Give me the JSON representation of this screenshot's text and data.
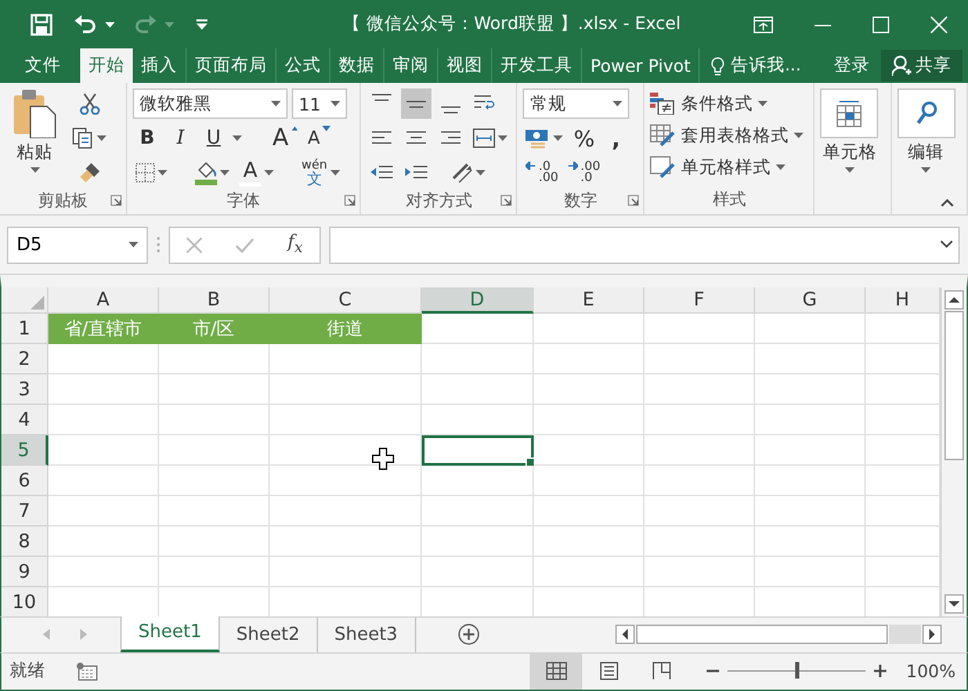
{
  "window": {
    "title": "【 微信公众号：Word联盟 】.xlsx - Excel"
  },
  "tabs": [
    {
      "label": "文件",
      "selected": false
    },
    {
      "label": "开始",
      "selected": true
    },
    {
      "label": "插入",
      "selected": false
    },
    {
      "label": "页面布局",
      "selected": false
    },
    {
      "label": "公式",
      "selected": false
    },
    {
      "label": "数据",
      "selected": false
    },
    {
      "label": "审阅",
      "selected": false
    },
    {
      "label": "视图",
      "selected": false
    },
    {
      "label": "开发工具",
      "selected": false
    },
    {
      "label": "Power Pivot",
      "selected": false
    }
  ],
  "tell_me": "告诉我...",
  "sign_in": "登录",
  "share": "共享",
  "ribbon": {
    "clipboard": {
      "label": "剪贴板",
      "paste": "粘贴"
    },
    "font": {
      "label": "字体",
      "font_name": "微软雅黑",
      "font_size": "11",
      "format_buttons": [
        {
          "kind": "bold",
          "label": "B"
        },
        {
          "kind": "italic",
          "label": "I"
        },
        {
          "kind": "underline",
          "label": "U"
        }
      ],
      "size_buttons": [
        {
          "kind": "grow",
          "label": "A"
        },
        {
          "kind": "shrink",
          "label": "A"
        }
      ],
      "font_color": "A",
      "phonetic": {
        "top": "wén",
        "bottom": "文"
      }
    },
    "alignment": {
      "label": "对齐方式",
      "vertical": [
        {
          "kind": "top",
          "selected": false
        },
        {
          "kind": "middle",
          "selected": true
        },
        {
          "kind": "bottom",
          "selected": false
        }
      ]
    },
    "number": {
      "label": "数字",
      "format": "常规",
      "percent": "%",
      "comma": ",",
      "increase_decimal": [
        ".0",
        ".00"
      ],
      "decrease_decimal": [
        ".00",
        ".0"
      ]
    },
    "styles": {
      "label": "样式",
      "buttons": [
        {
          "kind": "conditional",
          "label": "条件格式"
        },
        {
          "kind": "table",
          "label": "套用表格格式"
        },
        {
          "kind": "cell",
          "label": "单元格样式"
        }
      ]
    },
    "cells": {
      "label": "单元格"
    },
    "editing": {
      "label": "编辑"
    }
  },
  "formula_bar": {
    "name_box": "D5",
    "fx": "f$_{x}$"
  },
  "sheet": {
    "columns": [
      {
        "label": "A",
        "selected": false
      },
      {
        "label": "B",
        "selected": false
      },
      {
        "label": "C",
        "selected": false
      },
      {
        "label": "D",
        "selected": true
      },
      {
        "label": "E",
        "selected": false
      },
      {
        "label": "F",
        "selected": false
      },
      {
        "label": "G",
        "selected": false
      },
      {
        "label": "H",
        "selected": false
      }
    ],
    "rows": [
      {
        "label": "1",
        "selected": false,
        "cells": [
          {
            "text": "省/直辖市",
            "color": "#70ad47"
          },
          {
            "text": "市/区",
            "color": "#70ad47"
          },
          {
            "text": "街道",
            "color": "#70ad47"
          }
        ]
      },
      {
        "label": "2",
        "selected": false,
        "cells": []
      },
      {
        "label": "3",
        "selected": false,
        "cells": []
      },
      {
        "label": "4",
        "selected": false,
        "cells": []
      },
      {
        "label": "5",
        "selected": true,
        "cells": []
      },
      {
        "label": "6",
        "selected": false,
        "cells": []
      },
      {
        "label": "7",
        "selected": false,
        "cells": []
      },
      {
        "label": "8",
        "selected": false,
        "cells": []
      },
      {
        "label": "9",
        "selected": false,
        "cells": []
      },
      {
        "label": "10",
        "selected": false,
        "cells": []
      }
    ]
  },
  "sheet_tabs": [
    {
      "label": "Sheet1",
      "selected": true
    },
    {
      "label": "Sheet2",
      "selected": false
    },
    {
      "label": "Sheet3",
      "selected": false
    }
  ],
  "status_bar": {
    "status": "就绪",
    "views": [
      {
        "kind": "normal",
        "selected": true
      },
      {
        "kind": "layout",
        "selected": false
      },
      {
        "kind": "pagebreak",
        "selected": false
      }
    ],
    "zoom": {
      "level": 0.5
    },
    "zoom_text": "100%"
  }
}
